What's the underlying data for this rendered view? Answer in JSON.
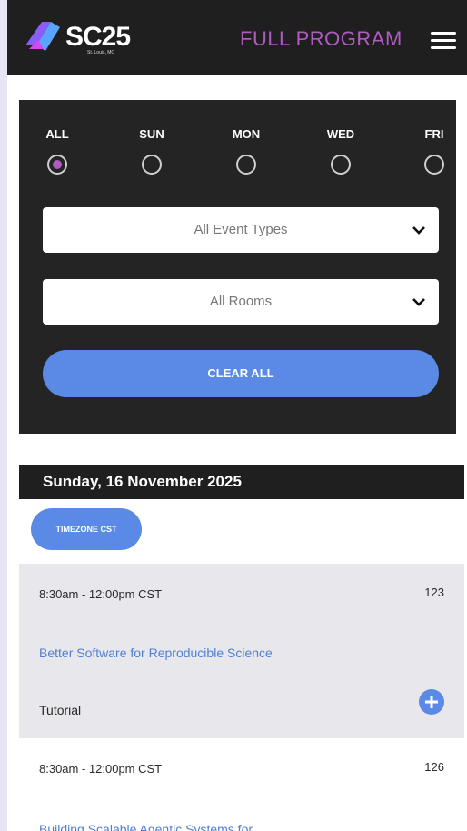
{
  "header": {
    "logo_text": "SC25",
    "logo_tagline": "St. Louis, MO",
    "program_link": "FULL PROGRAM"
  },
  "filters": {
    "days": [
      {
        "label": "ALL",
        "checked": true
      },
      {
        "label": "SUN",
        "checked": false
      },
      {
        "label": "MON",
        "checked": false
      },
      {
        "label": "WED",
        "checked": false
      },
      {
        "label": "FRI",
        "checked": false
      }
    ],
    "event_type_select": "All Event Types",
    "room_select": "All Rooms",
    "clear_all": "CLEAR ALL"
  },
  "schedule": {
    "date_heading": "Sunday, 16 November 2025",
    "timezone_badge": "TIMEZONE CST",
    "events": [
      {
        "time": "8:30am - 12:00pm CST",
        "room": "123",
        "title": "Better Software for Reproducible Science",
        "type": "Tutorial"
      },
      {
        "time": "8:30am - 12:00pm CST",
        "room": "126",
        "title": "Building Scalable Agentic Systems for"
      }
    ]
  },
  "colors": {
    "accent_purple": "#b05ac2",
    "accent_blue": "#5a8ae6",
    "header_bg": "#1f1f1f",
    "link_blue": "#4f7fd3"
  }
}
